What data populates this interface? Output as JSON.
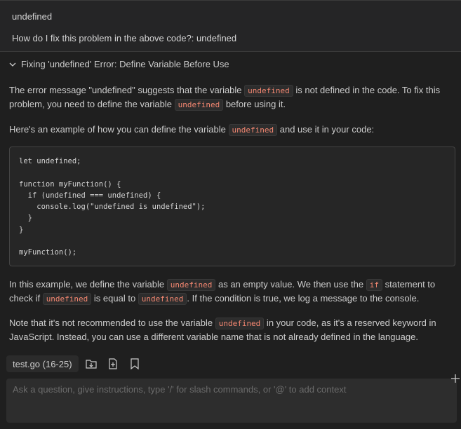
{
  "user_message": {
    "line1": "undefined",
    "line2": "How do I fix this problem in the above code?: undefined"
  },
  "response": {
    "title": "Fixing 'undefined' Error: Define Variable Before Use",
    "p1": {
      "a": "The error message \"undefined\" suggests that the variable ",
      "code1": "undefined",
      "b": " is not defined in the code. To fix this problem, you need to define the variable ",
      "code2": "undefined",
      "c": " before using it."
    },
    "p2": {
      "a": "Here's an example of how you can define the variable ",
      "code1": "undefined",
      "b": " and use it in your code:"
    },
    "code_block": "let undefined;\n\nfunction myFunction() {\n  if (undefined === undefined) {\n    console.log(\"undefined is undefined\");\n  }\n}\n\nmyFunction();",
    "p3": {
      "a": "In this example, we define the variable ",
      "code1": "undefined",
      "b": " as an empty value. We then use the ",
      "code2": "if",
      "c": " statement to check if ",
      "code3": "undefined",
      "d": " is equal to ",
      "code4": "undefined",
      "e": ". If the condition is true, we log a message to the console."
    },
    "p4": {
      "a": "Note that it's not recommended to use the variable ",
      "code1": "undefined",
      "b": " in your code, as it's a reserved keyword in JavaScript. Instead, you can use a different variable name that is not already defined in the language."
    }
  },
  "toolbar": {
    "file_chip": "test.go (16-25)",
    "icons": [
      "insert-at-cursor-icon",
      "new-file-icon",
      "bookmark-icon"
    ]
  },
  "input": {
    "placeholder": "Ask a question, give instructions, type '/' for slash commands, or '@' to add context"
  },
  "colors": {
    "background": "#1f1f1f",
    "inline_code": "#f48771",
    "code_block_bg": "#262626"
  }
}
